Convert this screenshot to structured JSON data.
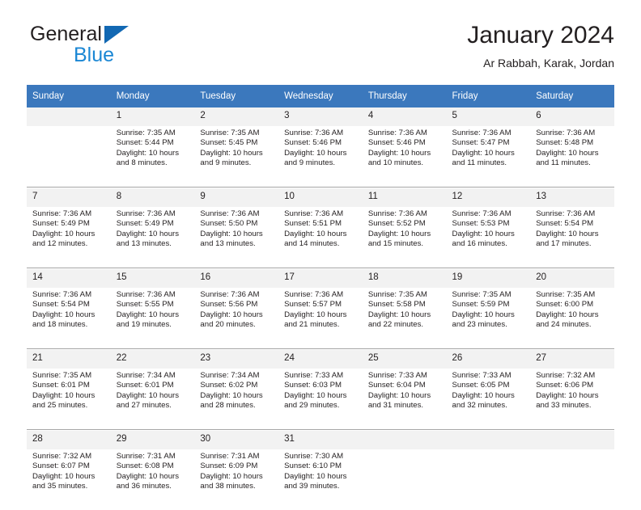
{
  "brand": {
    "name_part1": "General",
    "name_part2": "Blue",
    "triangle_color": "#1268b3",
    "blue_text_color": "#1b87d4"
  },
  "header": {
    "title": "January 2024",
    "location": "Ar Rabbah, Karak, Jordan"
  },
  "theme": {
    "header_bg": "#3b78bd",
    "header_text": "#ffffff",
    "daynum_bg": "#f2f2f2",
    "cell_bg": "#ffffff",
    "separator": "#a6a6a6",
    "text": "#231f20"
  },
  "weekday_headers": [
    "Sunday",
    "Monday",
    "Tuesday",
    "Wednesday",
    "Thursday",
    "Friday",
    "Saturday"
  ],
  "weeks": [
    {
      "days": [
        {
          "num": "",
          "sunrise": "",
          "sunset": "",
          "daylight_line1": "",
          "daylight_line2": ""
        },
        {
          "num": "1",
          "sunrise": "Sunrise: 7:35 AM",
          "sunset": "Sunset: 5:44 PM",
          "daylight_line1": "Daylight: 10 hours",
          "daylight_line2": "and 8 minutes."
        },
        {
          "num": "2",
          "sunrise": "Sunrise: 7:35 AM",
          "sunset": "Sunset: 5:45 PM",
          "daylight_line1": "Daylight: 10 hours",
          "daylight_line2": "and 9 minutes."
        },
        {
          "num": "3",
          "sunrise": "Sunrise: 7:36 AM",
          "sunset": "Sunset: 5:46 PM",
          "daylight_line1": "Daylight: 10 hours",
          "daylight_line2": "and 9 minutes."
        },
        {
          "num": "4",
          "sunrise": "Sunrise: 7:36 AM",
          "sunset": "Sunset: 5:46 PM",
          "daylight_line1": "Daylight: 10 hours",
          "daylight_line2": "and 10 minutes."
        },
        {
          "num": "5",
          "sunrise": "Sunrise: 7:36 AM",
          "sunset": "Sunset: 5:47 PM",
          "daylight_line1": "Daylight: 10 hours",
          "daylight_line2": "and 11 minutes."
        },
        {
          "num": "6",
          "sunrise": "Sunrise: 7:36 AM",
          "sunset": "Sunset: 5:48 PM",
          "daylight_line1": "Daylight: 10 hours",
          "daylight_line2": "and 11 minutes."
        }
      ]
    },
    {
      "days": [
        {
          "num": "7",
          "sunrise": "Sunrise: 7:36 AM",
          "sunset": "Sunset: 5:49 PM",
          "daylight_line1": "Daylight: 10 hours",
          "daylight_line2": "and 12 minutes."
        },
        {
          "num": "8",
          "sunrise": "Sunrise: 7:36 AM",
          "sunset": "Sunset: 5:49 PM",
          "daylight_line1": "Daylight: 10 hours",
          "daylight_line2": "and 13 minutes."
        },
        {
          "num": "9",
          "sunrise": "Sunrise: 7:36 AM",
          "sunset": "Sunset: 5:50 PM",
          "daylight_line1": "Daylight: 10 hours",
          "daylight_line2": "and 13 minutes."
        },
        {
          "num": "10",
          "sunrise": "Sunrise: 7:36 AM",
          "sunset": "Sunset: 5:51 PM",
          "daylight_line1": "Daylight: 10 hours",
          "daylight_line2": "and 14 minutes."
        },
        {
          "num": "11",
          "sunrise": "Sunrise: 7:36 AM",
          "sunset": "Sunset: 5:52 PM",
          "daylight_line1": "Daylight: 10 hours",
          "daylight_line2": "and 15 minutes."
        },
        {
          "num": "12",
          "sunrise": "Sunrise: 7:36 AM",
          "sunset": "Sunset: 5:53 PM",
          "daylight_line1": "Daylight: 10 hours",
          "daylight_line2": "and 16 minutes."
        },
        {
          "num": "13",
          "sunrise": "Sunrise: 7:36 AM",
          "sunset": "Sunset: 5:54 PM",
          "daylight_line1": "Daylight: 10 hours",
          "daylight_line2": "and 17 minutes."
        }
      ]
    },
    {
      "days": [
        {
          "num": "14",
          "sunrise": "Sunrise: 7:36 AM",
          "sunset": "Sunset: 5:54 PM",
          "daylight_line1": "Daylight: 10 hours",
          "daylight_line2": "and 18 minutes."
        },
        {
          "num": "15",
          "sunrise": "Sunrise: 7:36 AM",
          "sunset": "Sunset: 5:55 PM",
          "daylight_line1": "Daylight: 10 hours",
          "daylight_line2": "and 19 minutes."
        },
        {
          "num": "16",
          "sunrise": "Sunrise: 7:36 AM",
          "sunset": "Sunset: 5:56 PM",
          "daylight_line1": "Daylight: 10 hours",
          "daylight_line2": "and 20 minutes."
        },
        {
          "num": "17",
          "sunrise": "Sunrise: 7:36 AM",
          "sunset": "Sunset: 5:57 PM",
          "daylight_line1": "Daylight: 10 hours",
          "daylight_line2": "and 21 minutes."
        },
        {
          "num": "18",
          "sunrise": "Sunrise: 7:35 AM",
          "sunset": "Sunset: 5:58 PM",
          "daylight_line1": "Daylight: 10 hours",
          "daylight_line2": "and 22 minutes."
        },
        {
          "num": "19",
          "sunrise": "Sunrise: 7:35 AM",
          "sunset": "Sunset: 5:59 PM",
          "daylight_line1": "Daylight: 10 hours",
          "daylight_line2": "and 23 minutes."
        },
        {
          "num": "20",
          "sunrise": "Sunrise: 7:35 AM",
          "sunset": "Sunset: 6:00 PM",
          "daylight_line1": "Daylight: 10 hours",
          "daylight_line2": "and 24 minutes."
        }
      ]
    },
    {
      "days": [
        {
          "num": "21",
          "sunrise": "Sunrise: 7:35 AM",
          "sunset": "Sunset: 6:01 PM",
          "daylight_line1": "Daylight: 10 hours",
          "daylight_line2": "and 25 minutes."
        },
        {
          "num": "22",
          "sunrise": "Sunrise: 7:34 AM",
          "sunset": "Sunset: 6:01 PM",
          "daylight_line1": "Daylight: 10 hours",
          "daylight_line2": "and 27 minutes."
        },
        {
          "num": "23",
          "sunrise": "Sunrise: 7:34 AM",
          "sunset": "Sunset: 6:02 PM",
          "daylight_line1": "Daylight: 10 hours",
          "daylight_line2": "and 28 minutes."
        },
        {
          "num": "24",
          "sunrise": "Sunrise: 7:33 AM",
          "sunset": "Sunset: 6:03 PM",
          "daylight_line1": "Daylight: 10 hours",
          "daylight_line2": "and 29 minutes."
        },
        {
          "num": "25",
          "sunrise": "Sunrise: 7:33 AM",
          "sunset": "Sunset: 6:04 PM",
          "daylight_line1": "Daylight: 10 hours",
          "daylight_line2": "and 31 minutes."
        },
        {
          "num": "26",
          "sunrise": "Sunrise: 7:33 AM",
          "sunset": "Sunset: 6:05 PM",
          "daylight_line1": "Daylight: 10 hours",
          "daylight_line2": "and 32 minutes."
        },
        {
          "num": "27",
          "sunrise": "Sunrise: 7:32 AM",
          "sunset": "Sunset: 6:06 PM",
          "daylight_line1": "Daylight: 10 hours",
          "daylight_line2": "and 33 minutes."
        }
      ]
    },
    {
      "days": [
        {
          "num": "28",
          "sunrise": "Sunrise: 7:32 AM",
          "sunset": "Sunset: 6:07 PM",
          "daylight_line1": "Daylight: 10 hours",
          "daylight_line2": "and 35 minutes."
        },
        {
          "num": "29",
          "sunrise": "Sunrise: 7:31 AM",
          "sunset": "Sunset: 6:08 PM",
          "daylight_line1": "Daylight: 10 hours",
          "daylight_line2": "and 36 minutes."
        },
        {
          "num": "30",
          "sunrise": "Sunrise: 7:31 AM",
          "sunset": "Sunset: 6:09 PM",
          "daylight_line1": "Daylight: 10 hours",
          "daylight_line2": "and 38 minutes."
        },
        {
          "num": "31",
          "sunrise": "Sunrise: 7:30 AM",
          "sunset": "Sunset: 6:10 PM",
          "daylight_line1": "Daylight: 10 hours",
          "daylight_line2": "and 39 minutes."
        },
        {
          "num": "",
          "sunrise": "",
          "sunset": "",
          "daylight_line1": "",
          "daylight_line2": ""
        },
        {
          "num": "",
          "sunrise": "",
          "sunset": "",
          "daylight_line1": "",
          "daylight_line2": ""
        },
        {
          "num": "",
          "sunrise": "",
          "sunset": "",
          "daylight_line1": "",
          "daylight_line2": ""
        }
      ]
    }
  ]
}
